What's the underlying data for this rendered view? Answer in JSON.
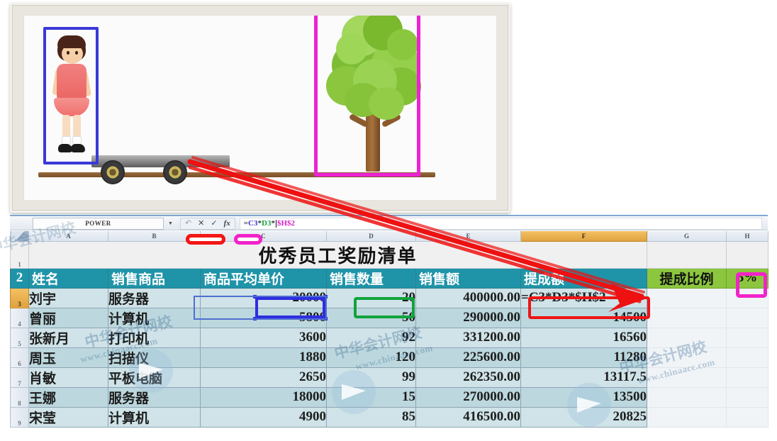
{
  "illustration": {
    "name": "relative-absolute-reference-analogy",
    "girl_label": "girl-on-cart",
    "tree_label": "tree-fixed",
    "blue_box_label": "blue-selection-box",
    "magenta_box_label": "magenta-selection-box"
  },
  "formula_bar": {
    "name_box": "POWER",
    "dropdown_caret": "▼",
    "cancel_icon": "✕",
    "accept_icon": "✓",
    "function_icon": "fx",
    "undo_icon": "↶",
    "formula_tokens": [
      {
        "text": "=",
        "color": "#2f3236"
      },
      {
        "text": "C3",
        "color": "#3a38d8"
      },
      {
        "text": "*",
        "color": "#2f3236"
      },
      {
        "text": "D3",
        "color": "#13a33d"
      },
      {
        "text": "*",
        "color": "#2f3236"
      },
      {
        "text": "$H$2",
        "color": "#d41fc4"
      }
    ],
    "formula_text": "=C3*D3*$H$2"
  },
  "sheet": {
    "column_letters": [
      "A",
      "B",
      "C",
      "D",
      "E",
      "F",
      "G",
      "H"
    ],
    "active_column": "F",
    "active_row": "3",
    "row_numbers": [
      "1",
      "2",
      "3",
      "4",
      "5",
      "6",
      "7",
      "8",
      "9"
    ],
    "title": "优秀员工奖励清单",
    "headers": {
      "a": "姓名",
      "b": "销售商品",
      "c": "商品平均单价",
      "d": "销售数量",
      "e": "销售额",
      "f": "提成额",
      "g": "提成比例",
      "h": "5%"
    },
    "rows": [
      {
        "row": "3",
        "name": "刘宇",
        "product": "服务器",
        "price": "20000",
        "qty": "20",
        "amount": "400000.00",
        "commission": "=C3*D3*$H$2"
      },
      {
        "row": "4",
        "name": "曾丽",
        "product": "计算机",
        "price": "5800",
        "qty": "50",
        "amount": "290000.00",
        "commission": "14500"
      },
      {
        "row": "5",
        "name": "张新月",
        "product": "打印机",
        "price": "3600",
        "qty": "92",
        "amount": "331200.00",
        "commission": "16560"
      },
      {
        "row": "6",
        "name": "周玉",
        "product": "扫描仪",
        "price": "1880",
        "qty": "120",
        "amount": "225600.00",
        "commission": "11280"
      },
      {
        "row": "7",
        "name": "肖敏",
        "product": "平板电脑",
        "price": "2650",
        "qty": "99",
        "amount": "262350.00",
        "commission": "13117.5"
      },
      {
        "row": "8",
        "name": "王娜",
        "product": "服务器",
        "price": "18000",
        "qty": "15",
        "amount": "270000.00",
        "commission": "13500"
      },
      {
        "row": "9",
        "name": "宋莹",
        "product": "计算机",
        "price": "4900",
        "qty": "85",
        "amount": "416500.00",
        "commission": "20825"
      }
    ]
  },
  "annotations": {
    "blue_box_target": "C3",
    "green_box_target": "D3",
    "red_box_target": "F3",
    "magenta_box_target": "H2",
    "red_pill_label": "red-pill-marker",
    "magenta_pill_label": "magenta-pill-marker",
    "arrow_label": "red-pointer-arrow"
  },
  "watermarks": {
    "brand": "中华会计网校",
    "url": "www.chinaacc.com"
  },
  "colors": {
    "header_teal": "#1f94a8",
    "row_fill": "#cfe3e8",
    "row_fill_alt": "#bcd8de",
    "green_fill": "#8cc63e",
    "active_header": "#e0a23f",
    "annotation_blue": "#2f2de0",
    "annotation_green": "#11a33c",
    "annotation_red": "#ef1414",
    "annotation_magenta": "#f222c9"
  }
}
